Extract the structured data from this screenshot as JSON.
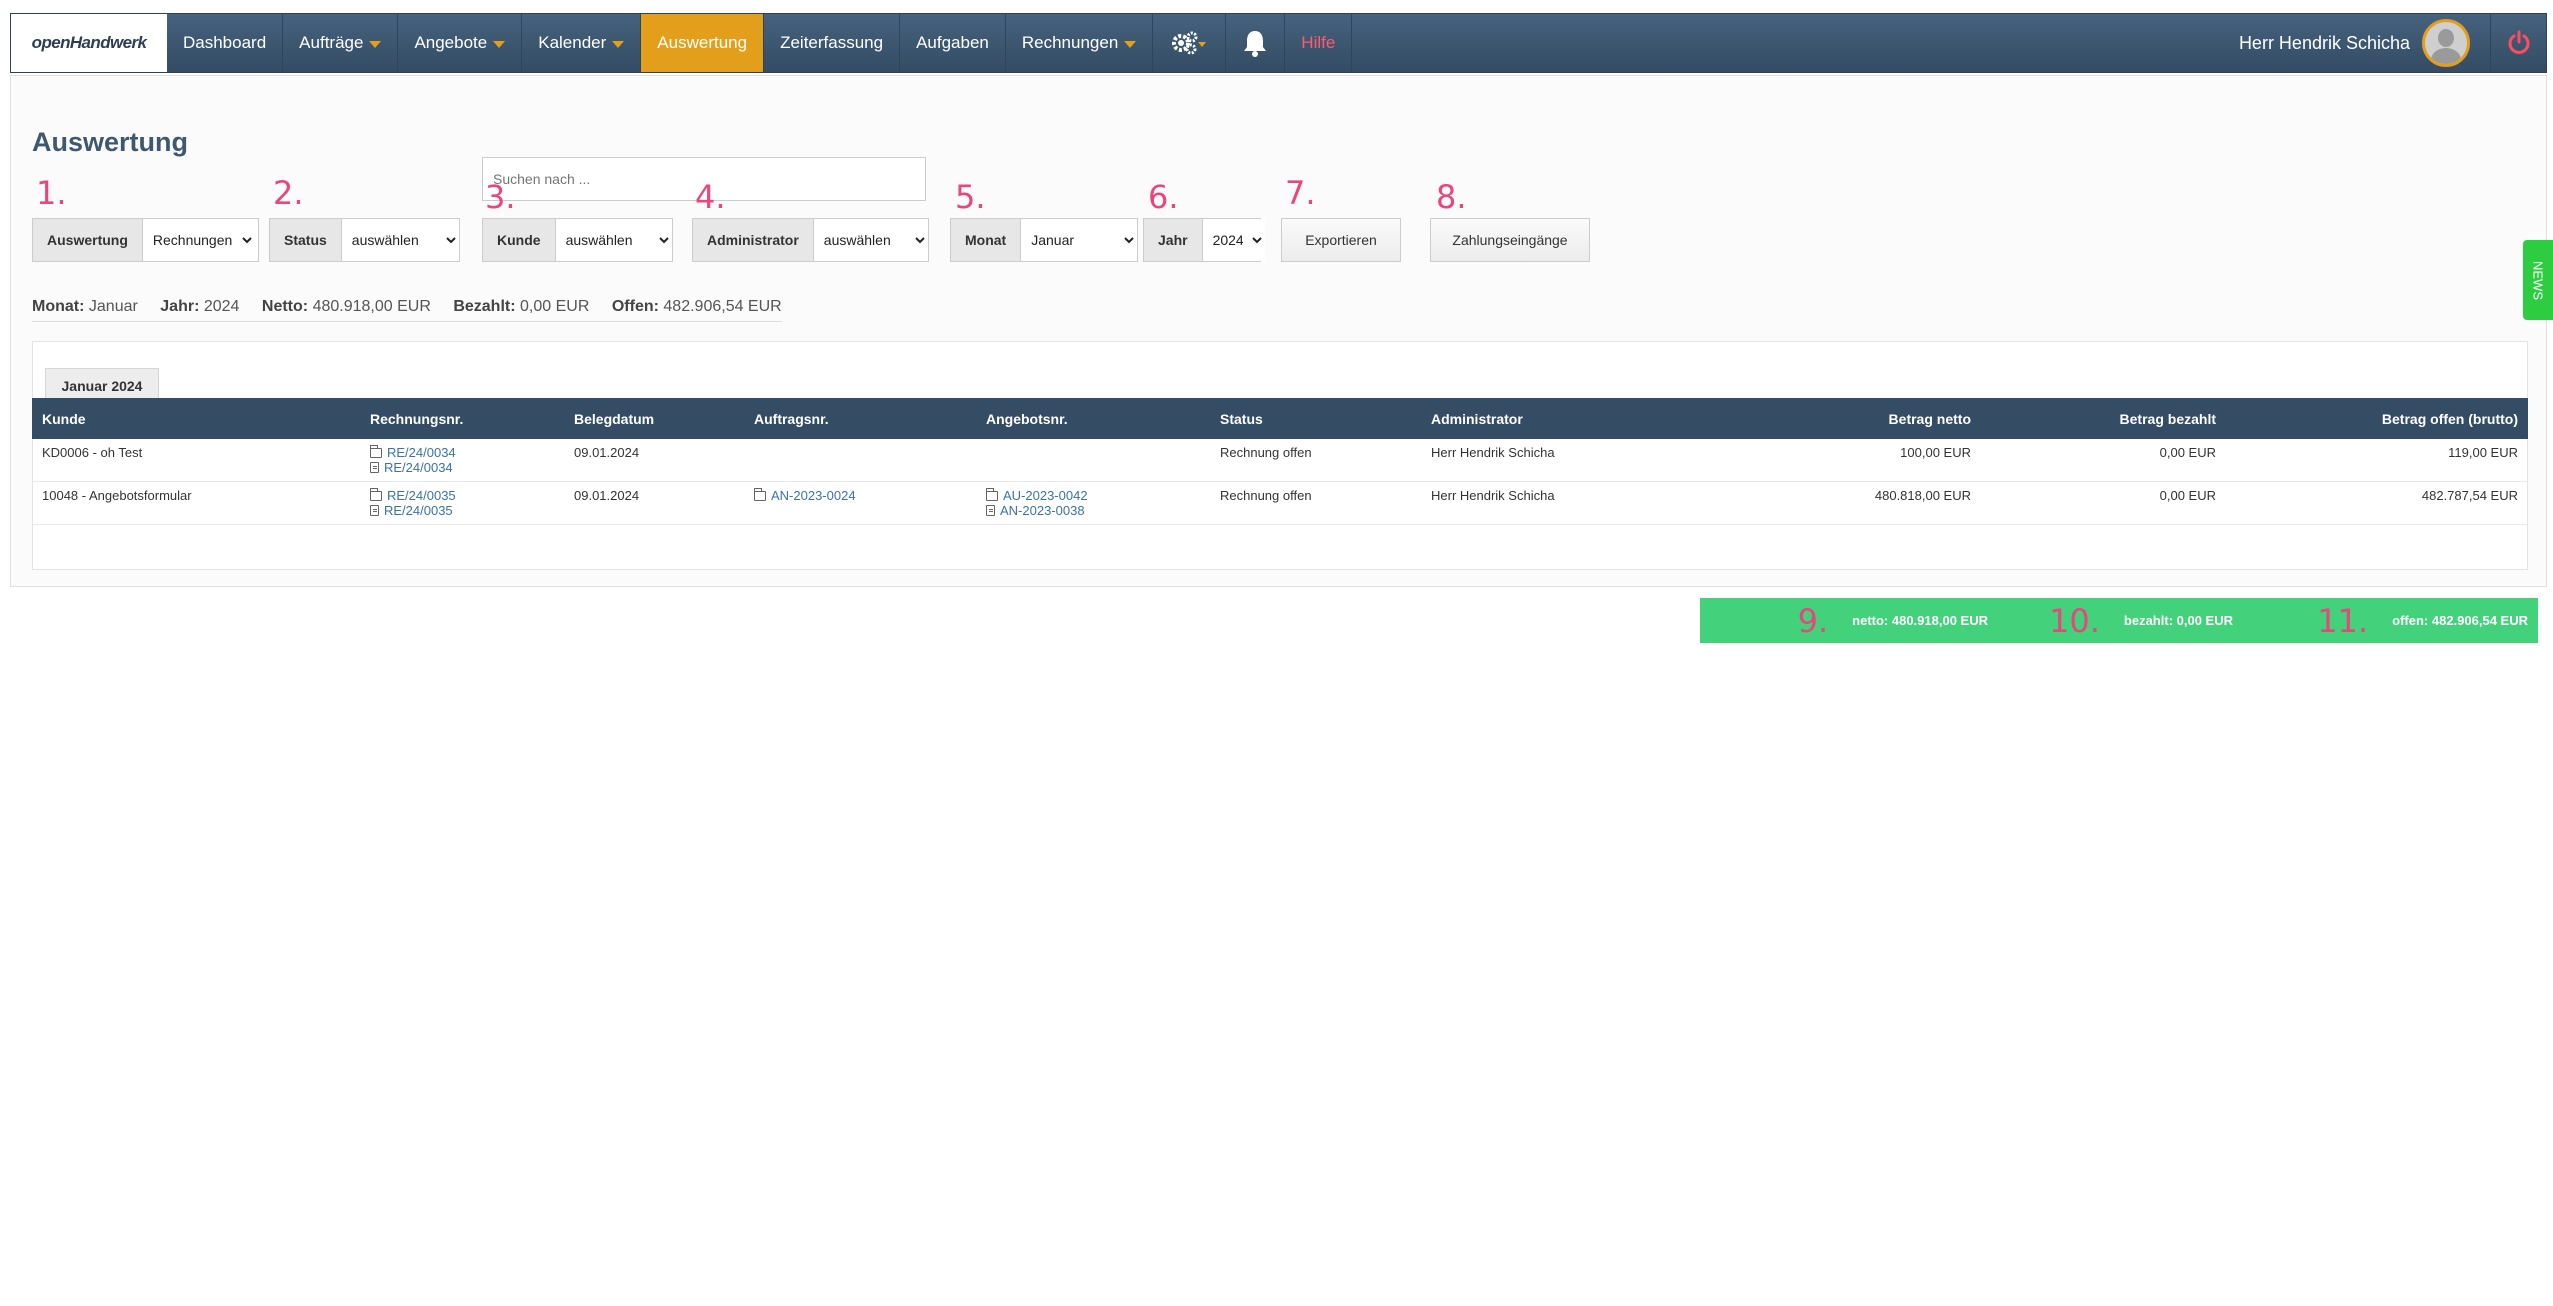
{
  "nav": {
    "logo": "openHandwerk",
    "items": [
      {
        "label": "Dashboard",
        "caret": false,
        "active": false
      },
      {
        "label": "Aufträge",
        "caret": true,
        "active": false
      },
      {
        "label": "Angebote",
        "caret": true,
        "active": false
      },
      {
        "label": "Kalender",
        "caret": true,
        "active": false
      },
      {
        "label": "Auswertung",
        "caret": false,
        "active": true
      },
      {
        "label": "Zeiterfassung",
        "caret": false,
        "active": false
      },
      {
        "label": "Aufgaben",
        "caret": false,
        "active": false
      },
      {
        "label": "Rechnungen",
        "caret": true,
        "active": false
      }
    ],
    "help": "Hilfe",
    "user": "Herr Hendrik Schicha"
  },
  "page": {
    "title": "Auswertung",
    "search_placeholder": "Suchen nach ..."
  },
  "filters": {
    "n1": "1.",
    "n2": "2.",
    "n3": "3.",
    "n4": "4.",
    "n5": "5.",
    "n6": "6.",
    "n7": "7.",
    "n8": "8.",
    "auswertung_label": "Auswertung",
    "auswertung_value": "Rechnungen",
    "status_label": "Status",
    "status_value": "auswählen",
    "kunde_label": "Kunde",
    "kunde_value": "auswählen",
    "admin_label": "Administrator",
    "admin_value": "auswählen",
    "monat_label": "Monat",
    "monat_value": "Januar",
    "jahr_label": "Jahr",
    "jahr_value": "2024",
    "export_label": "Exportieren",
    "payments_label": "Zahlungseingänge"
  },
  "summary": {
    "monat_label": "Monat:",
    "monat": "Januar",
    "jahr_label": "Jahr:",
    "jahr": "2024",
    "netto_label": "Netto:",
    "netto": "480.918,00 EUR",
    "bezahlt_label": "Bezahlt:",
    "bezahlt": "0,00 EUR",
    "offen_label": "Offen:",
    "offen": "482.906,54 EUR"
  },
  "tab": "Januar 2024",
  "table": {
    "headers": [
      "Kunde",
      "Rechnungsnr.",
      "Belegdatum",
      "Auftragsnr.",
      "Angebotsnr.",
      "Status",
      "Administrator",
      "Betrag netto",
      "Betrag bezahlt",
      "Betrag offen (brutto)"
    ],
    "rows": [
      {
        "kunde": "KD0006 - oh Test",
        "rechnung1": "RE/24/0034",
        "rechnung2": "RE/24/0034",
        "datum": "09.01.2024",
        "auftrag": "",
        "angebot1": "",
        "angebot2": "",
        "status": "Rechnung offen",
        "admin": "Herr Hendrik Schicha",
        "netto": "100,00 EUR",
        "bezahlt": "0,00 EUR",
        "offen": "119,00 EUR"
      },
      {
        "kunde": "10048 - Angebotsformular",
        "rechnung1": "RE/24/0035",
        "rechnung2": "RE/24/0035",
        "datum": "09.01.2024",
        "auftrag": "AN-2023-0024",
        "angebot1": "AU-2023-0042",
        "angebot2": "AN-2023-0038",
        "status": "Rechnung offen",
        "admin": "Herr Hendrik Schicha",
        "netto": "480.818,00 EUR",
        "bezahlt": "0,00 EUR",
        "offen": "482.787,54 EUR"
      }
    ]
  },
  "totals": {
    "n9": "9.",
    "n10": "10.",
    "n11": "11.",
    "netto": "netto: 480.918,00 EUR",
    "bezahlt": "bezahlt: 0,00 EUR",
    "offen": "offen: 482.906,54 EUR"
  },
  "news": "NEWS",
  "colors": {
    "accent": "#e39f1c",
    "navbar": "#3e5870",
    "totals": "#43d17c",
    "marker": "#e8467c"
  }
}
